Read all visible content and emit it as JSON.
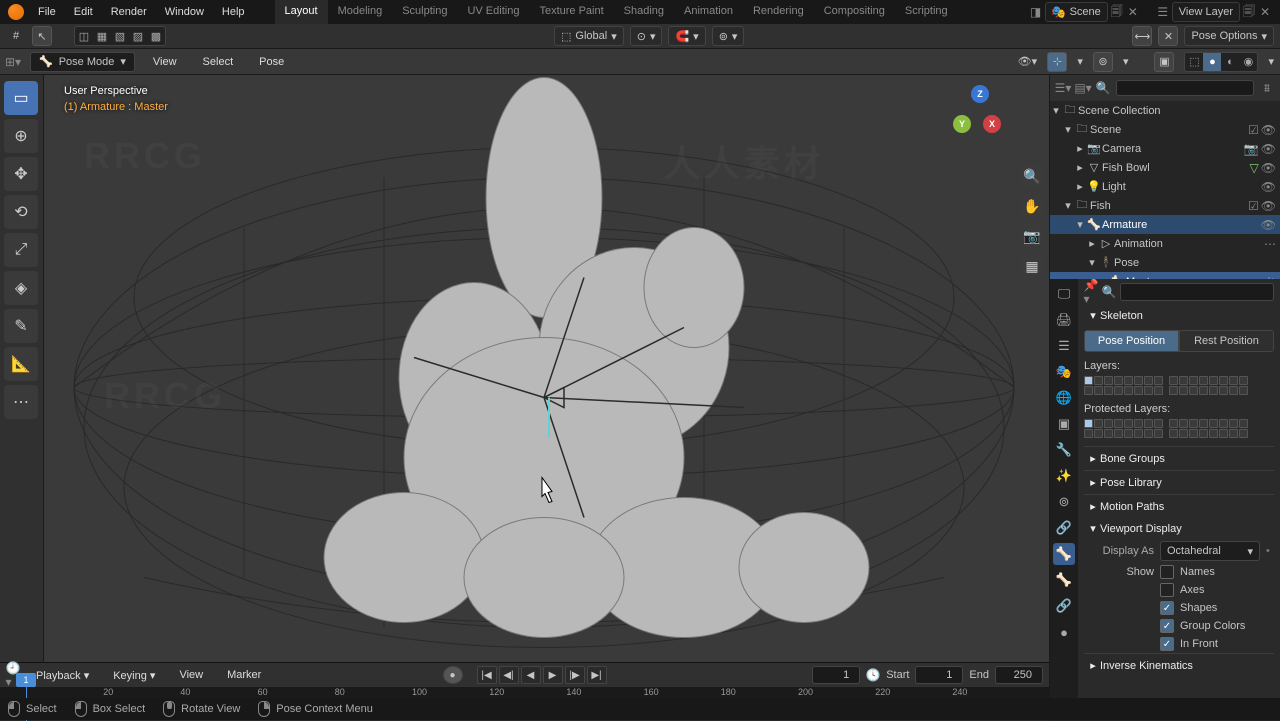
{
  "top_menu": {
    "items": [
      "File",
      "Edit",
      "Render",
      "Window",
      "Help"
    ]
  },
  "workspaces": {
    "items": [
      "Layout",
      "Modeling",
      "Sculpting",
      "UV Editing",
      "Texture Paint",
      "Shading",
      "Animation",
      "Rendering",
      "Compositing",
      "Scripting"
    ],
    "active": "Layout"
  },
  "scene": {
    "name": "Scene",
    "viewlayer": "View Layer"
  },
  "header2": {
    "orientation": "Global",
    "pose_options": "Pose Options"
  },
  "mode": {
    "current": "Pose Mode",
    "menus": [
      "View",
      "Select",
      "Pose"
    ]
  },
  "viewport": {
    "title": "User Perspective",
    "sub": "(1) Armature : Master"
  },
  "timeline": {
    "playback": "Playback",
    "keying": "Keying",
    "view": "View",
    "marker": "Marker",
    "current": 1,
    "start_label": "Start",
    "start": 1,
    "end_label": "End",
    "end": 250,
    "ticks": [
      20,
      40,
      60,
      80,
      100,
      120,
      140,
      160,
      180,
      200,
      220,
      240
    ]
  },
  "statusbar": {
    "select": "Select",
    "box": "Box Select",
    "rotate": "Rotate View",
    "context": "Pose Context Menu"
  },
  "outliner": {
    "root": "Scene Collection",
    "scene": "Scene",
    "items": [
      {
        "name": "Camera",
        "icon": "📷"
      },
      {
        "name": "Fish Bowl",
        "icon": "▽"
      },
      {
        "name": "Light",
        "icon": "💡"
      }
    ],
    "fish": "Fish",
    "armature": "Armature",
    "animation": "Animation",
    "pose": "Pose",
    "master": "Master"
  },
  "properties": {
    "skeleton": "Skeleton",
    "pose_position": "Pose Position",
    "rest_position": "Rest Position",
    "layers": "Layers:",
    "protected_layers": "Protected Layers:",
    "bone_groups": "Bone Groups",
    "pose_library": "Pose Library",
    "motion_paths": "Motion Paths",
    "viewport_display": "Viewport Display",
    "display_as": "Display As",
    "display_as_value": "Octahedral",
    "show": "Show",
    "checks": {
      "names": {
        "label": "Names",
        "on": false
      },
      "axes": {
        "label": "Axes",
        "on": false
      },
      "shapes": {
        "label": "Shapes",
        "on": true
      },
      "group_colors": {
        "label": "Group Colors",
        "on": true
      },
      "in_front": {
        "label": "In Front",
        "on": true
      }
    },
    "inverse_kinematics": "Inverse Kinematics"
  }
}
